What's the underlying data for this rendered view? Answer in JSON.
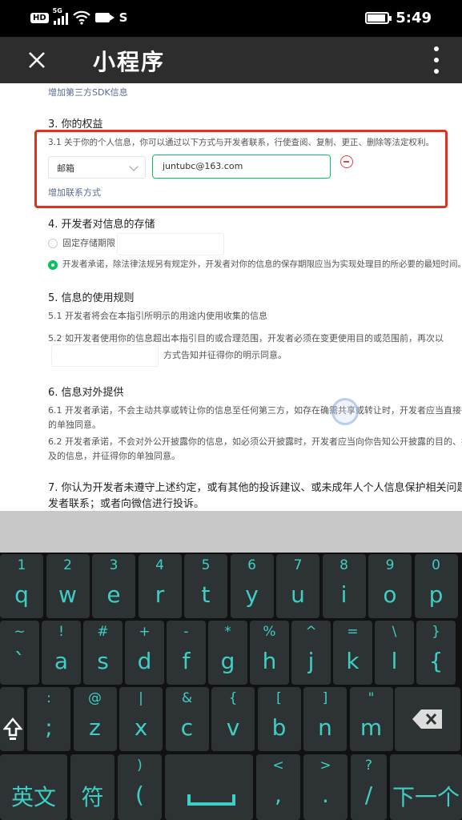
{
  "status_bar": {
    "hd": "HD",
    "network": "5G",
    "s_icon": "S",
    "time": "5:49"
  },
  "title_bar": {
    "title": "小程序",
    "close_icon": "close-icon",
    "more_icon": "more-vertical-icon"
  },
  "content": {
    "sdk_link": "增加第三方SDK信息",
    "sec3_title": "3.  你的权益",
    "sec3_1": "3.1  关于你的个人信息，你可以通过以下方式与开发者联系，行使查阅、复制、更正、删除等法定权利。",
    "contact_type": "邮箱",
    "contact_value": "juntubc@163.com",
    "add_contact": "增加联系方式",
    "sec4_title": "4.  开发者对信息的存储",
    "sec4_opt1": "固定存储期限",
    "sec4_opt2": "开发者承诺，除法律法规另有规定外，开发者对你的信息的保存期限应当为实现处理目的所必要的最短时间。",
    "sec5_title": "5.  信息的使用规则",
    "sec5_1": "5.1  开发者将会在本指引所明示的用途内使用收集的信息",
    "sec5_2": "5.2  如开发者使用你的信息超出本指引目的或合理范围，开发者必须在变更使用目的或范围前，再次以",
    "sec5_2b": "方式告知并征得你的明示同意。",
    "sec6_title": "6.  信息对外提供",
    "sec6_1a": "6.1  开发者承诺，不会主动共享或转让你的信息至任何第三方，如存在确需共享或转让时，开发者应当直接征得或",
    "sec6_1b": "的单独同意。",
    "sec6_2a": "6.2  开发者承诺，不会对外公开披露你的信息，如必须公开披露时，开发者应当向你告知公开披露的目的、披露信",
    "sec6_2b": "及的信息，并征得你的单独同意。",
    "sec7a": "7.  你认为开发者未遵守上述约定，或有其他的投诉建议、或未成年人个人信息保护相关问题，可通",
    "sec7b": "发者联系；或者向微信进行投诉。"
  },
  "keyboard": {
    "row1": [
      {
        "sub": "1",
        "main": "q"
      },
      {
        "sub": "2",
        "main": "w"
      },
      {
        "sub": "3",
        "main": "e"
      },
      {
        "sub": "4",
        "main": "r"
      },
      {
        "sub": "5",
        "main": "t"
      },
      {
        "sub": "6",
        "main": "y"
      },
      {
        "sub": "7",
        "main": "u"
      },
      {
        "sub": "8",
        "main": "i"
      },
      {
        "sub": "9",
        "main": "o"
      },
      {
        "sub": "0",
        "main": "p"
      }
    ],
    "row2": [
      {
        "sub": "~",
        "main": "`"
      },
      {
        "sub": "!",
        "main": "a"
      },
      {
        "sub": "#",
        "main": "s"
      },
      {
        "sub": "+",
        "main": "d"
      },
      {
        "sub": "-",
        "main": "f"
      },
      {
        "sub": "*",
        "main": "g"
      },
      {
        "sub": "%",
        "main": "h"
      },
      {
        "sub": "^",
        "main": "j"
      },
      {
        "sub": "=",
        "main": "k"
      },
      {
        "sub": "\\",
        "main": "l"
      },
      {
        "sub": "}",
        "main": "{"
      }
    ],
    "row3": [
      {
        "sub": ":",
        "main": ";"
      },
      {
        "sub": "@",
        "main": "z"
      },
      {
        "sub": "|",
        "main": "x"
      },
      {
        "sub": "&",
        "main": "c"
      },
      {
        "sub": "{",
        "main": "v"
      },
      {
        "sub": "[",
        "main": "b"
      },
      {
        "sub": "]",
        "main": "n"
      },
      {
        "sub": "\"",
        "main": "m"
      }
    ],
    "row4": {
      "lang": "英文",
      "sym": "符",
      "paren_sub": ")",
      "paren_main": "(",
      "lt_sub": "<",
      "lt_main": ",",
      "gt_sub": ">",
      "gt_main": ".",
      "q_sub": "?",
      "q_main": "/",
      "next": "下一个"
    },
    "shift_icon": "shift-icon",
    "backspace_icon": "backspace-icon",
    "space_icon": "space-icon"
  }
}
